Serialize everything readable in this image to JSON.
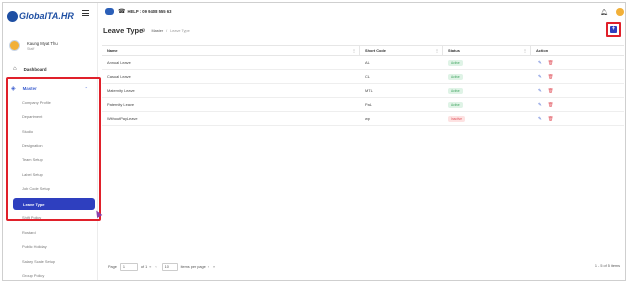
{
  "app": {
    "logo_main": "Global",
    "logo_suffix": "TA.HR"
  },
  "user": {
    "name": "Kaung Myat Thu",
    "role": "Staff"
  },
  "topbar": {
    "help_text": "HELP : 09 9408 555 63"
  },
  "sidebar": {
    "dashboard": "Dashboard",
    "master": "Master",
    "items": [
      {
        "label": "Company Profile",
        "active": false
      },
      {
        "label": "Department",
        "active": false
      },
      {
        "label": "Studio",
        "active": false
      },
      {
        "label": "Designation",
        "active": false
      },
      {
        "label": "Team Setup",
        "active": false
      },
      {
        "label": "Label Setup",
        "active": false
      },
      {
        "label": "Job Code Setup",
        "active": false
      },
      {
        "label": "Leave Type",
        "active": true
      },
      {
        "label": "Shift Policy",
        "active": false
      },
      {
        "label": "Rostard",
        "active": false
      },
      {
        "label": "Public Holiday",
        "active": false
      },
      {
        "label": "Salary Scale Setup",
        "active": false
      },
      {
        "label": "Group Policy",
        "active": false
      }
    ]
  },
  "page": {
    "title": "Leave Type",
    "breadcrumb": [
      "Master",
      "Leave Type"
    ],
    "add_label": "+"
  },
  "table": {
    "columns": [
      "Name",
      "Short Code",
      "Status",
      "Action"
    ],
    "rows": [
      {
        "name": "Annual Leave",
        "code": "AL",
        "status": "Active"
      },
      {
        "name": "Casual Leave",
        "code": "CL",
        "status": "Active"
      },
      {
        "name": "Maternity Leave",
        "code": "MTL",
        "status": "Active"
      },
      {
        "name": "Paternity Leave",
        "code": "PaL",
        "status": "Active"
      },
      {
        "name": "WithoutPayLeave",
        "code": "wp",
        "status": "Inactive"
      }
    ]
  },
  "pagination": {
    "page_label": "Page",
    "page_value": "1",
    "of_label": "of 1",
    "first": "«",
    "prev": "‹",
    "page_size": "10",
    "items_label": "items per page",
    "next": "›",
    "last": "»",
    "summary": "1 - 5 of 5 items"
  },
  "colors": {
    "primary": "#2e3fbf",
    "highlight": "#e0202a",
    "active_badge": "#3fa55f",
    "inactive_badge": "#e0505a"
  }
}
